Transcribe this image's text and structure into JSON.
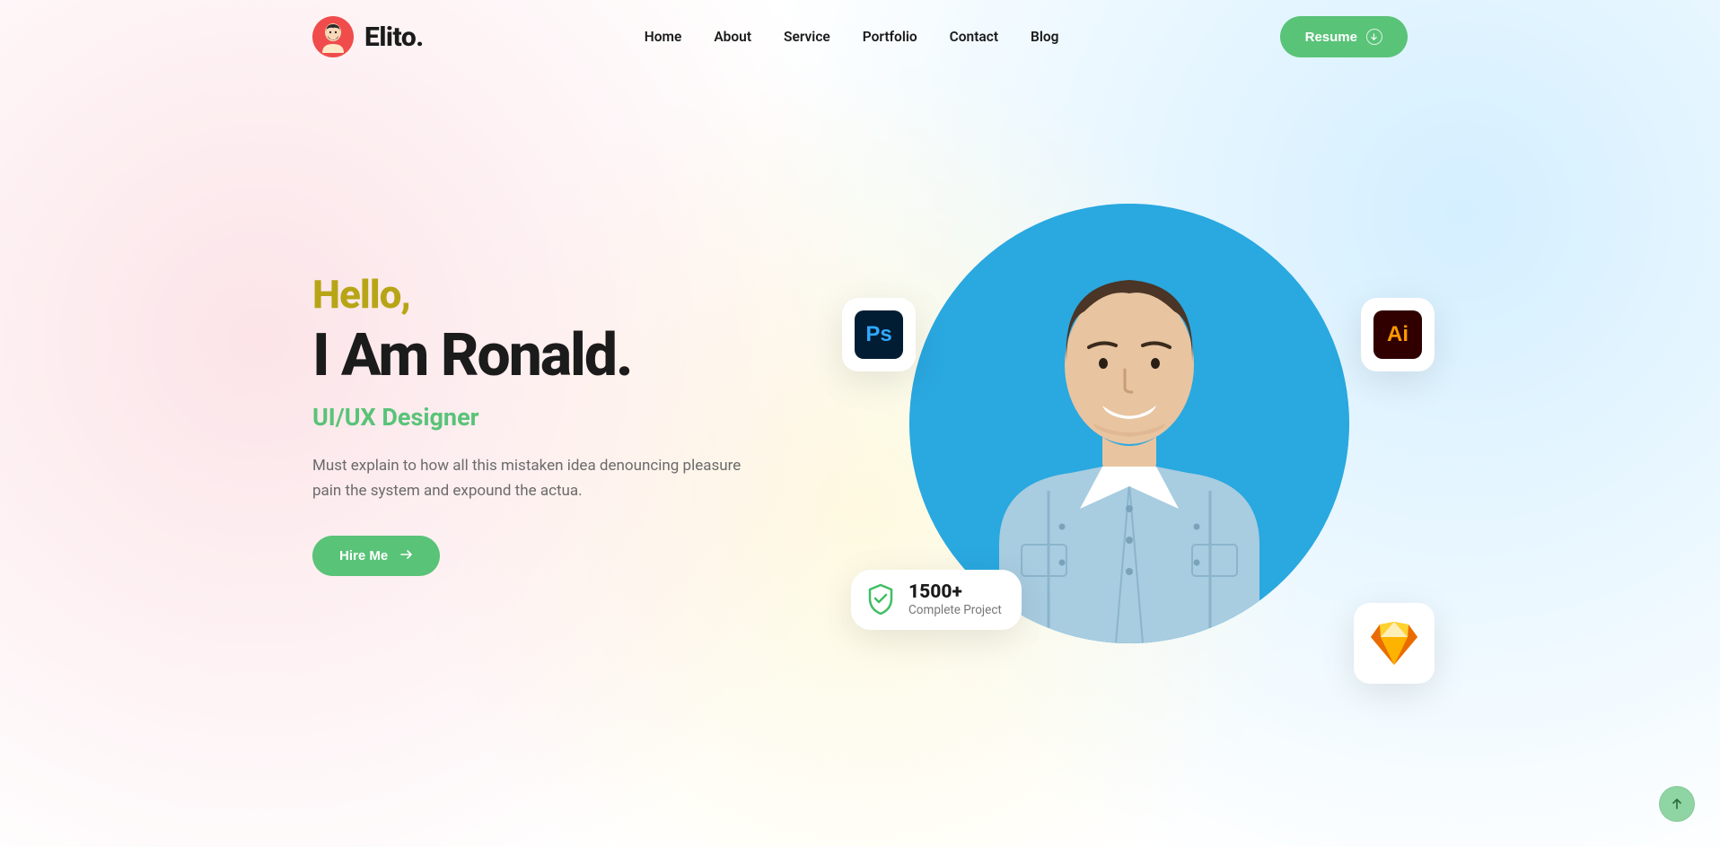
{
  "brand": {
    "name": "Elito."
  },
  "nav": {
    "items": [
      {
        "label": "Home"
      },
      {
        "label": "About"
      },
      {
        "label": "Service"
      },
      {
        "label": "Portfolio"
      },
      {
        "label": "Contact"
      },
      {
        "label": "Blog"
      }
    ]
  },
  "header": {
    "resume_label": "Resume"
  },
  "hero": {
    "greeting": "Hello,",
    "title": "I Am Ronald.",
    "role": "UI/UX Designer",
    "description": "Must explain to how all this mistaken idea denouncing pleasure pain the system and expound the actua.",
    "hire_label": "Hire Me"
  },
  "badges": {
    "ps": "Ps",
    "ai": "Ai",
    "sketch": "sketch-icon",
    "project_count": "1500+",
    "project_label": "Complete Project"
  }
}
